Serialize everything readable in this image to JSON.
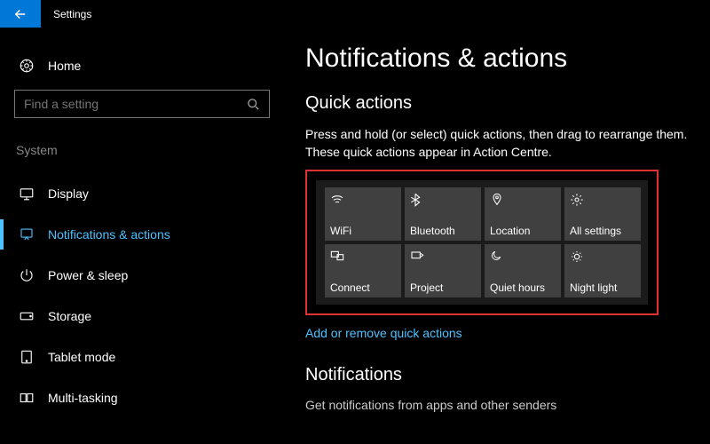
{
  "titlebar": {
    "title": "Settings"
  },
  "sidebar": {
    "home": "Home",
    "search_placeholder": "Find a setting",
    "section": "System",
    "items": [
      {
        "label": "Display"
      },
      {
        "label": "Notifications & actions"
      },
      {
        "label": "Power & sleep"
      },
      {
        "label": "Storage"
      },
      {
        "label": "Tablet mode"
      },
      {
        "label": "Multi-tasking"
      }
    ]
  },
  "main": {
    "title": "Notifications & actions",
    "quick_header": "Quick actions",
    "quick_desc": "Press and hold (or select) quick actions, then drag to rearrange them. These quick actions appear in Action Centre.",
    "tiles": [
      {
        "label": "WiFi"
      },
      {
        "label": "Bluetooth"
      },
      {
        "label": "Location"
      },
      {
        "label": "All settings"
      },
      {
        "label": "Connect"
      },
      {
        "label": "Project"
      },
      {
        "label": "Quiet hours"
      },
      {
        "label": "Night light"
      }
    ],
    "quick_link": "Add or remove quick actions",
    "notif_header": "Notifications",
    "notif_desc": "Get notifications from apps and other senders"
  }
}
